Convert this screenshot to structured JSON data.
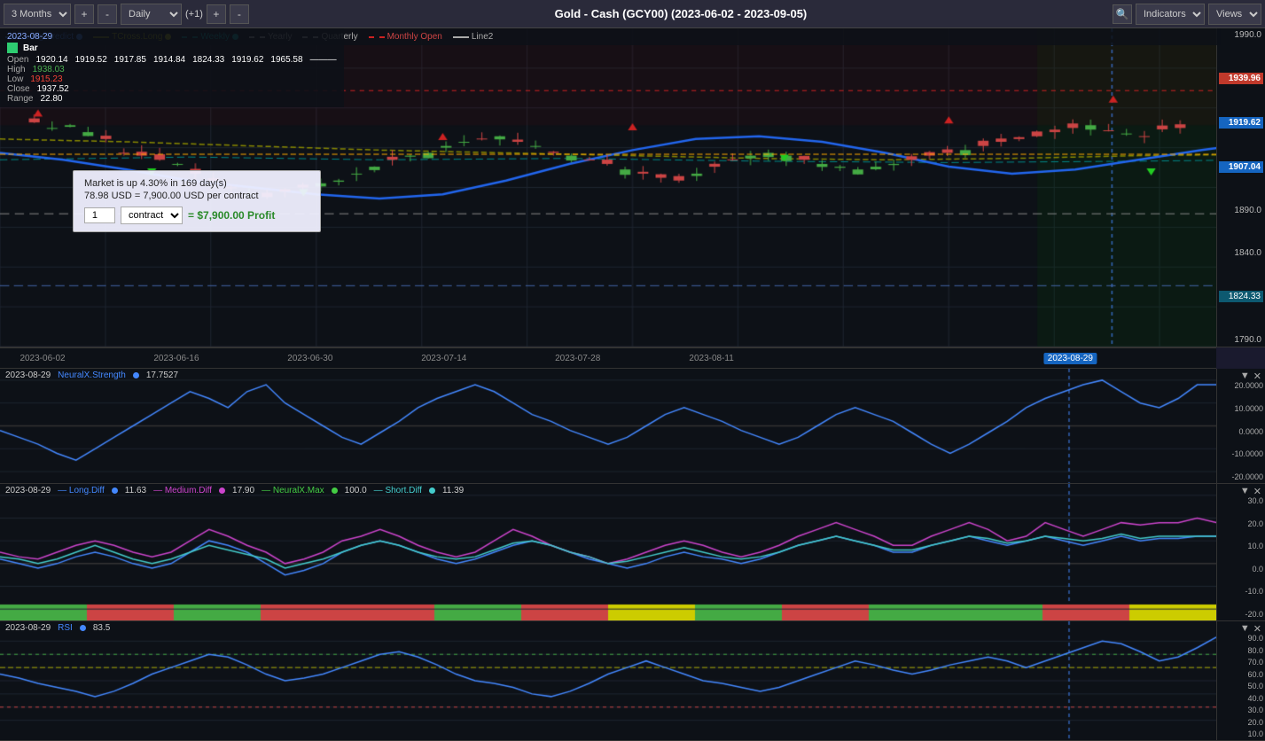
{
  "toolbar": {
    "period_label": "3 Months",
    "plus_label": "+",
    "minus_label": "-",
    "interval_label": "Daily",
    "shift_label": "(+1)",
    "title": "Gold - Cash (GCY00) (2023-06-02 - 2023-09-05)",
    "indicators_label": "Indicators",
    "views_label": "Views"
  },
  "price_chart": {
    "date_label": "2023-08-29",
    "bar_type": "Bar",
    "ohlc": {
      "open_label": "Open",
      "open_val": "1920.14",
      "high_label": "High",
      "high_val": "1938.03",
      "low_label": "Low",
      "low_val": "1915.23",
      "close_label": "Close",
      "close_val": "1937.52",
      "range_label": "Range",
      "range_val": "22.80"
    },
    "legend": [
      {
        "name": "Long.Predict",
        "color": "#4488ff",
        "type": "line"
      },
      {
        "name": "TCross.Long",
        "color": "#888800",
        "type": "dashed"
      },
      {
        "name": "Weekly",
        "color": "#008888",
        "type": "dashed"
      },
      {
        "name": "Yearly",
        "color": "#aaaaaa",
        "type": "dashed"
      },
      {
        "name": "Quarterly",
        "color": "#888888",
        "type": "dashed"
      },
      {
        "name": "Monthly Open",
        "color": "#cc2222",
        "type": "dashed"
      },
      {
        "name": "Line2",
        "color": "#888888",
        "type": "line"
      }
    ],
    "popup": {
      "line1": "Market is up 4.30% in 169 day(s)",
      "line2": "78.98 USD = 7,900.00 USD per contract",
      "contracts": "1",
      "contract_type": "contract",
      "profit": "= $7,900.00 Profit"
    },
    "price_levels": [
      {
        "val": "1990.0",
        "type": "normal"
      },
      {
        "val": "1939.96",
        "type": "highlight-red"
      },
      {
        "val": "1919.62",
        "type": "highlight-blue"
      },
      {
        "val": "1907.04",
        "type": "highlight-blue"
      },
      {
        "val": "1890.0",
        "type": "normal"
      },
      {
        "val": "1840.0",
        "type": "normal"
      },
      {
        "val": "1824.33",
        "type": "highlight-teal"
      },
      {
        "val": "1790.0",
        "type": "normal"
      }
    ],
    "dates": [
      {
        "label": "2023-06-02",
        "pct": 3.5
      },
      {
        "label": "2023-06-16",
        "pct": 14.5
      },
      {
        "label": "2023-06-30",
        "pct": 25.5
      },
      {
        "label": "2023-07-14",
        "pct": 36.5
      },
      {
        "label": "2023-07-28",
        "pct": 47.5
      },
      {
        "label": "2023-08-11",
        "pct": 58.5
      },
      {
        "label": "2023-08-29",
        "pct": 88,
        "highlight": true
      }
    ]
  },
  "neuralx_panel": {
    "date": "2023-08-29",
    "title": "NeuralX.Strength",
    "value": "17.7527",
    "y_labels": [
      "20.0000",
      "10.0000",
      "0.0000",
      "-10.0000",
      "-20.0000"
    ]
  },
  "diff_panel": {
    "date": "2023-08-29",
    "indicators": [
      {
        "name": "Long.Diff",
        "color": "#4488ff",
        "val": "11.63"
      },
      {
        "name": "Medium.Diff",
        "color": "#cc44cc",
        "val": "17.90"
      },
      {
        "name": "NeuralX.Max",
        "color": "#44cc44",
        "val": "100.0"
      },
      {
        "name": "Short.Diff",
        "color": "#44cccc",
        "val": "11.39"
      }
    ],
    "y_labels": [
      "30.0",
      "20.0",
      "10.0",
      "0.0",
      "-10.0",
      "-20.0"
    ]
  },
  "rsi_panel": {
    "date": "2023-08-29",
    "title": "RSI",
    "value": "83.5",
    "y_labels": [
      "90.0",
      "80.0",
      "70.0",
      "60.0",
      "50.0",
      "40.0",
      "30.0",
      "20.0",
      "10.0"
    ]
  }
}
